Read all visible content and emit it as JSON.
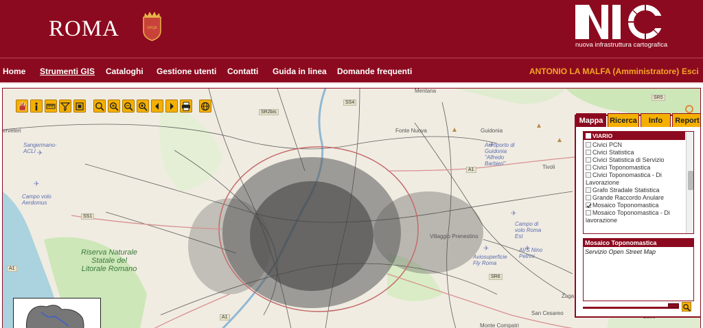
{
  "header": {
    "city_logo": "ROMA",
    "nic_logo": "NIC",
    "nic_tagline": "nuova infrastruttura cartografica"
  },
  "nav": {
    "items": [
      "Home",
      "Strumenti GIS",
      "Cataloghi",
      "Gestione utenti",
      "Contatti",
      "Guida in linea",
      "Domande frequenti"
    ],
    "active": "Strumenti GIS",
    "user": "ANTONIO LA MALFA (Amministratore)",
    "logout": "Esci"
  },
  "map": {
    "labels": {
      "mentana": "Mentana",
      "fonte_nuova": "Fonte Nuova",
      "guidonia": "Guidonia",
      "aeroporto": "Aeroporto di Guidonia \"Alfredo Barbieri\"",
      "tivoli": "Tivoli",
      "sangermano": "Sangermano-ACLI",
      "campo_aerdomus": "Campo volo Aerdomus",
      "campo_roma_est": "Campo di volo Roma Est",
      "villaggio_prenestino": "Villaggio Prenestino",
      "aviosuperficie": "Aviosuperficie Fly Roma",
      "avs_nino": "AVS Nino Petrini",
      "riserva": "Riserva Naturale Statale del Litorale Romano",
      "san_cesareo": "San Cesareo",
      "monte_compatri": "Monte Compatri",
      "cave": "Cave",
      "zagarolo": "Zaga",
      "cerveteri": "erveteri"
    },
    "roads": [
      "SR2bis",
      "SS4",
      "A1",
      "SS1",
      "SR6",
      "A1",
      "SR5",
      "A1"
    ]
  },
  "toolbar": {
    "tools": [
      "pan-hand",
      "info",
      "measure-distance",
      "filter-funnel",
      "zoom-extent",
      "zoom-box",
      "zoom-in",
      "zoom-out",
      "zoom-layer",
      "previous-view",
      "next-view",
      "print",
      "globe"
    ]
  },
  "panel": {
    "tabs": [
      "Mappa",
      "Ricerca",
      "Info",
      "Report"
    ],
    "active_tab": "Mappa",
    "layer_group": "VIARIO",
    "layers": [
      {
        "label": "Civici PCN",
        "checked": false
      },
      {
        "label": "Civici Statistica",
        "checked": false
      },
      {
        "label": "Civici Statistica di Servizio",
        "checked": false
      },
      {
        "label": "Civici Toponomastica",
        "checked": false
      },
      {
        "label": "Civici Toponomastica - Di",
        "checked": false
      },
      {
        "label": "Lavorazione",
        "checked": null
      },
      {
        "label": "Grafo Stradale Statistica",
        "checked": false
      },
      {
        "label": "Grande Raccordo Anulare",
        "checked": false
      },
      {
        "label": "Mosaico Toponomastica",
        "checked": true
      },
      {
        "label": "Mosaico Toponomastica - Di",
        "checked": false
      },
      {
        "label": "lavorazione",
        "checked": null
      }
    ],
    "info_title": "Mosaico Toponomastica",
    "info_text": "Servizio Open Street Map",
    "opacity": 0.95
  },
  "colors": {
    "brand": "#8c0a1f",
    "accent": "#f4b000",
    "user": "#f5a623"
  }
}
